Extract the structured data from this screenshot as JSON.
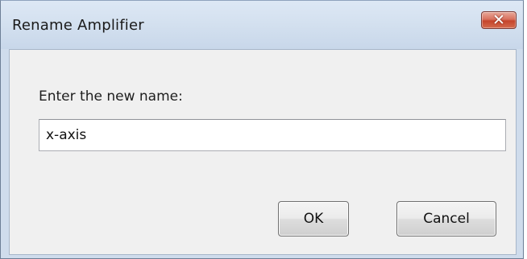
{
  "window": {
    "title": "Rename Amplifier",
    "close_glyph": "✕",
    "close_icon": "close-icon"
  },
  "form": {
    "prompt": "Enter the new name:",
    "name_value": "x-axis"
  },
  "buttons": {
    "ok_label": "OK",
    "cancel_label": "Cancel"
  },
  "colors": {
    "close_button": "#c5452c",
    "titlebar": "#d3e0ef"
  }
}
